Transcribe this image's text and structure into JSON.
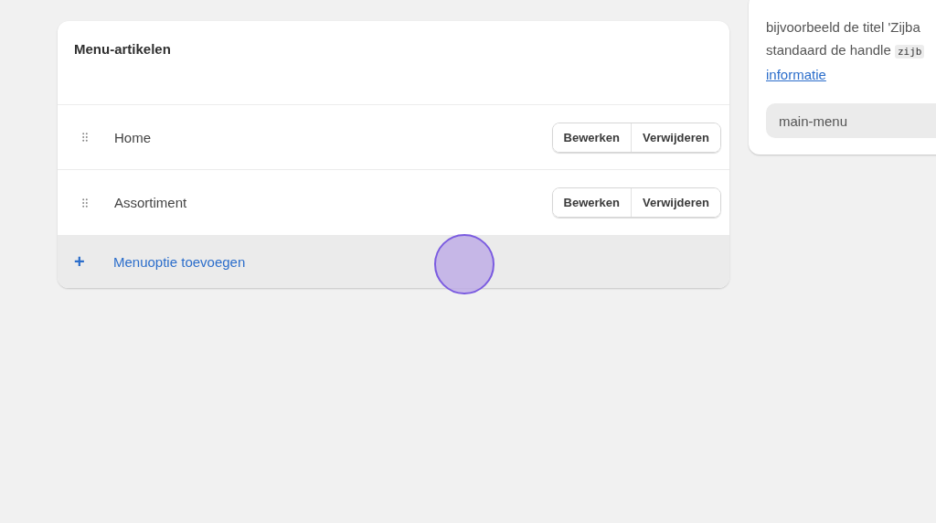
{
  "menu_items_card": {
    "title": "Menu-artikelen",
    "items": [
      {
        "label": "Home",
        "buttons": [
          "Bewerken",
          "Verwijderen"
        ]
      },
      {
        "label": "Assortiment",
        "buttons": [
          "Bewerken",
          "Verwijderen"
        ]
      }
    ],
    "add_item": {
      "icon": "+",
      "label": "Menuoptie toevoegen"
    }
  },
  "handle_card": {
    "lines": [
      {
        "text": "bijvoorbeeld de titel 'Zijba"
      },
      {
        "text": "standaard de handle ",
        "code": "zijb"
      }
    ],
    "link": "informatie",
    "field": {
      "value": "main-menu"
    }
  }
}
